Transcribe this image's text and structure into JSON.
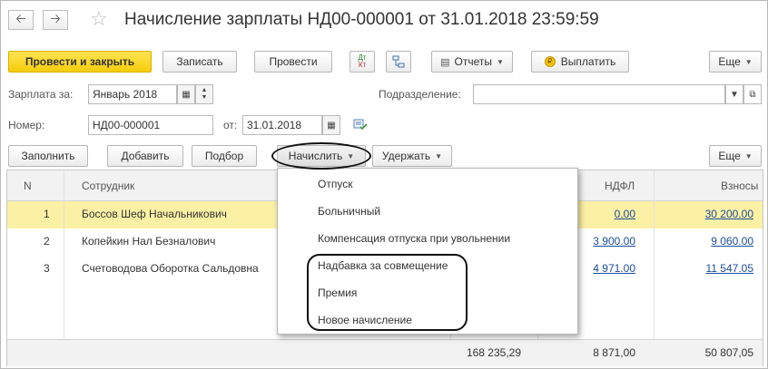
{
  "window": {
    "title": "Начисление зарплаты НД00-000001 от 31.01.2018 23:59:59"
  },
  "toolbar": {
    "post_close": "Провести и закрыть",
    "save": "Записать",
    "post": "Провести",
    "reports": "Отчеты",
    "pay": "Выплатить",
    "more": "Еще"
  },
  "form": {
    "salary_for_label": "Зарплата за:",
    "salary_for_value": "Январь 2018",
    "department_label": "Подразделение:",
    "department_value": "",
    "number_label": "Номер:",
    "number_value": "НД00-000001",
    "date_label": "от:",
    "date_value": "31.01.2018"
  },
  "table_toolbar": {
    "fill": "Заполнить",
    "add": "Добавить",
    "select": "Подбор",
    "accrue": "Начислить",
    "withhold": "Удержать",
    "more": "Еще"
  },
  "table": {
    "columns": [
      "N",
      "Сотрудник",
      "НДФЛ",
      "Взносы"
    ],
    "rows": [
      {
        "n": "1",
        "employee": "Боссов Шеф Начальникович",
        "ndfl": "0.00",
        "contrib": "30 200.00"
      },
      {
        "n": "2",
        "employee": "Копейкин Нал Безналович",
        "ndfl": "3 900.00",
        "contrib": "9 060.00"
      },
      {
        "n": "3",
        "employee": "Счетоводова Оборотка Сальдовна",
        "ndfl": "4 971.00",
        "contrib": "11 547.05"
      }
    ],
    "totals": {
      "accrued": "168 235,29",
      "ndfl": "8 871,00",
      "contrib": "50 807,05"
    }
  },
  "dropdown": {
    "items": [
      "Отпуск",
      "Больничный",
      "Компенсация отпуска при увольнении",
      "Надбавка за совмещение",
      "Премия",
      "Новое начисление"
    ]
  },
  "colors": {
    "primary_button": "#f5cc0b",
    "selected_row": "#fbf0a4",
    "link": "#1c4c9c"
  }
}
